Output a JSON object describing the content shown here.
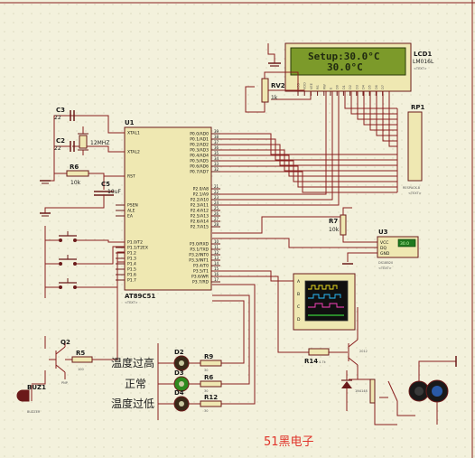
{
  "lcd": {
    "ref": "LCD1",
    "model": "LM016L",
    "line1": "Setup:30.0°C",
    "line2": "30.0°C",
    "pins": [
      "VSS",
      "VDD",
      "VEE",
      "RS",
      "RW",
      "E",
      "D0",
      "D1",
      "D2",
      "D3",
      "D4",
      "D5",
      "D6",
      "D7"
    ]
  },
  "mcu": {
    "ref": "U1",
    "model": "AT89C51",
    "left_pins": [
      "XTAL1",
      "XTAL2",
      "RST",
      "PSEN",
      "ALE",
      "EA",
      "P1.0/T2",
      "P1.1/T2EX",
      "P1.2",
      "P1.3",
      "P1.4",
      "P1.5",
      "P1.6",
      "P1.7"
    ],
    "right_pins": [
      "P0.0/AD0",
      "P0.1/AD1",
      "P0.2/AD2",
      "P0.3/AD3",
      "P0.4/AD4",
      "P0.5/AD5",
      "P0.6/AD6",
      "P0.7/AD7",
      "P2.0/A8",
      "P2.1/A9",
      "P2.2/A10",
      "P2.3/A11",
      "P2.4/A12",
      "P2.5/A13",
      "P2.6/A14",
      "P2.7/A15",
      "P3.0/RXD",
      "P3.1/TXD",
      "P3.2/INT0",
      "P3.3/INT1",
      "P3.4/T0",
      "P3.5/T1",
      "P3.6/WR",
      "P3.7/RD"
    ],
    "right_nums": [
      "39",
      "38",
      "37",
      "36",
      "35",
      "34",
      "33",
      "32",
      "21",
      "22",
      "23",
      "24",
      "25",
      "26",
      "27",
      "28",
      "10",
      "11",
      "12",
      "13",
      "14",
      "15",
      "16",
      "17"
    ]
  },
  "rp1": {
    "ref": "RP1",
    "model": "RESPACK-8"
  },
  "rv2": {
    "ref": "RV2",
    "value": "1k"
  },
  "c3": {
    "ref": "C3",
    "value": "22"
  },
  "c2": {
    "ref": "C2",
    "value": "22"
  },
  "x1": {
    "value": "12MHZ"
  },
  "r6": {
    "ref": "R6",
    "value": "10k"
  },
  "c5": {
    "ref": "C5",
    "value": "10uF"
  },
  "r7": {
    "ref": "R7",
    "value": "10k"
  },
  "u3": {
    "ref": "U3",
    "model": "DS18B20",
    "pins": [
      "VCC",
      "DQ",
      "GND"
    ],
    "display": "30.0"
  },
  "scope": {
    "channels": [
      "A",
      "B",
      "C",
      "D"
    ]
  },
  "q2": {
    "ref": "Q2",
    "model": "PNP"
  },
  "r5": {
    "ref": "R5",
    "value": "100"
  },
  "buz": {
    "ref": "BUZ1",
    "model": "BUZZER"
  },
  "leds": [
    {
      "ref": "D2",
      "res": "R9",
      "resval": "30",
      "label": "温度过高",
      "color": "#3a2a18"
    },
    {
      "ref": "D3",
      "res": "R6",
      "resval": "30",
      "label": "正常",
      "color": "#2e8a1e"
    },
    {
      "ref": "D4",
      "res": "R12",
      "resval": "30",
      "label": "温度过低",
      "color": "#3a2a18"
    }
  ],
  "r14": {
    "ref": "R14",
    "value": "4.7k"
  },
  "q1": {
    "model": "2012"
  },
  "d1": {
    "model": "1N4148"
  },
  "brand": "51黑电子",
  "text_tag": "<TEXT>"
}
